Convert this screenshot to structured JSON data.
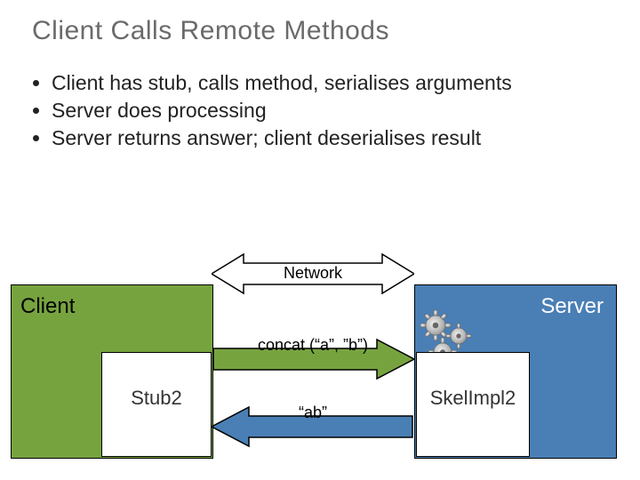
{
  "title": "Client Calls Remote Methods",
  "bullets": {
    "b1": "Client has stub, calls method, serialises arguments",
    "b2": "Server does processing",
    "b3": "Server returns answer; client deserialises result"
  },
  "diagram": {
    "client_label": "Client",
    "server_label": "Server",
    "stub_label": "Stub2",
    "skel_label": "SkelImpl2",
    "network_label": "Network",
    "call_label": "concat (“a”, ”b”)",
    "return_label": "“ab”"
  },
  "colors": {
    "client_fill": "#77a33f",
    "server_fill": "#4a7fb5",
    "call_arrow_fill": "#77a33f",
    "return_arrow_fill": "#4a7fb5"
  }
}
